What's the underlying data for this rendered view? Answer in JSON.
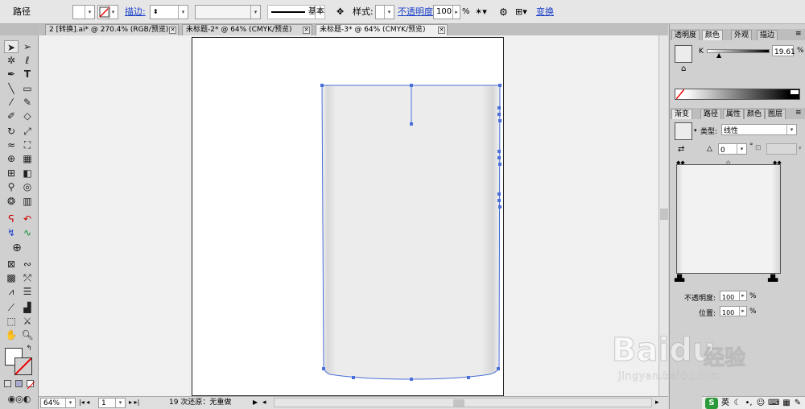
{
  "toolbar": {
    "object_type": "路径",
    "stroke_label": "描边:",
    "stroke_style": "基本",
    "style_label": "样式:",
    "opacity_label": "不透明度:",
    "opacity_value": "100",
    "opacity_unit": "%",
    "transform_label": "变换"
  },
  "tabs": [
    {
      "label": "2 [转换].ai* @ 270.4% (RGB/预览)",
      "active": false
    },
    {
      "label": "未标题-2* @ 64% (CMYK/预览)",
      "active": false
    },
    {
      "label": "未标题-3* @ 64% (CMYK/预览)",
      "active": true
    }
  ],
  "status": {
    "zoom": "64%",
    "page": "1",
    "undo_info": "19 次还原：无重做"
  },
  "color_panel": {
    "tabs": [
      "透明度",
      "颜色",
      "外观",
      "描边"
    ],
    "active_tab": "颜色",
    "channel": "K",
    "value": "19.61",
    "unit": "%"
  },
  "gradient_panel": {
    "tabs": [
      "渐变",
      "路径",
      "属性",
      "颜色",
      "图层"
    ],
    "active_tab": "渐变",
    "type_label": "类型:",
    "type_value": "线性",
    "angle_value": "0",
    "angle_unit": "°",
    "opacity_label": "不透明度:",
    "opacity_value": "100",
    "opacity_unit": "%",
    "location_label": "位置:",
    "location_value": "100",
    "location_unit": "%"
  },
  "watermark": {
    "brand": "Baidu",
    "brand_cn": "经验",
    "url": "jingyan.baidu.com"
  },
  "ime": {
    "lang": "英"
  },
  "colors": {
    "selection": "#4a6fd8",
    "link": "#1a3fc9"
  }
}
